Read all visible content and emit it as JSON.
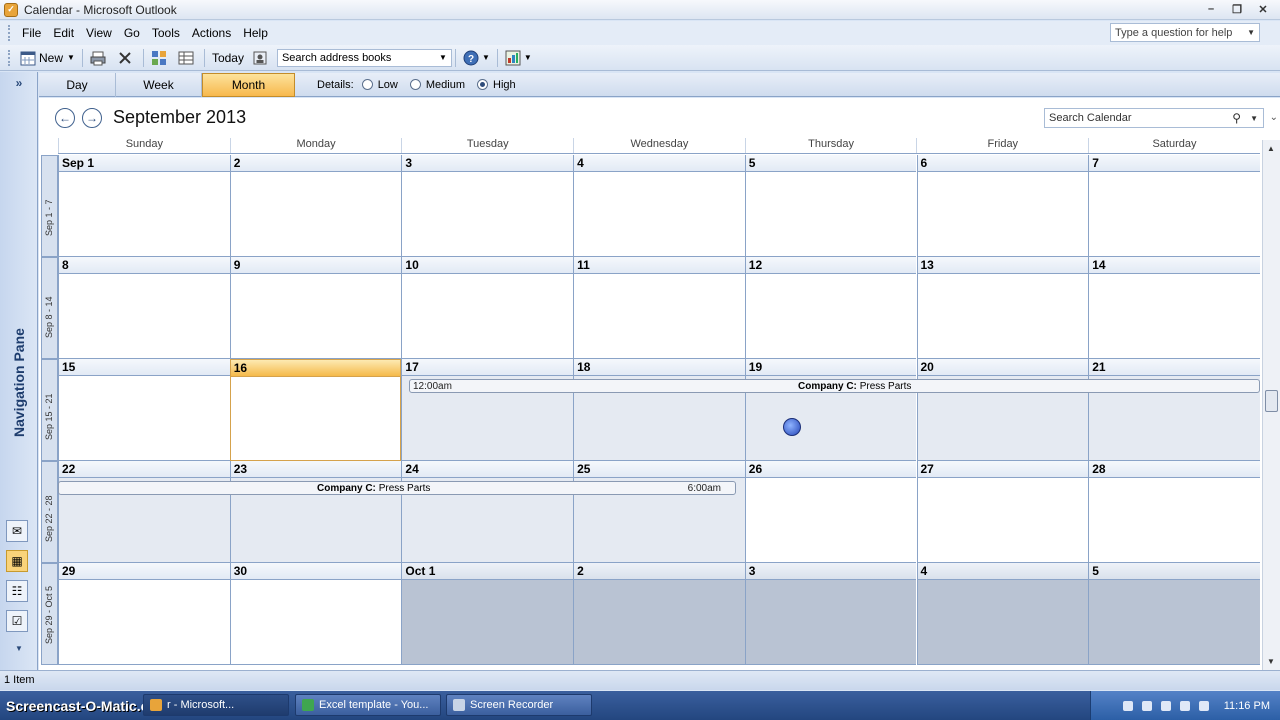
{
  "window": {
    "title": "Calendar - Microsoft Outlook"
  },
  "menu": [
    "File",
    "Edit",
    "View",
    "Go",
    "Tools",
    "Actions",
    "Help"
  ],
  "help": {
    "placeholder": "Type a question for help"
  },
  "toolbar": {
    "new_label": "New",
    "today_label": "Today",
    "address_search_placeholder": "Search address books"
  },
  "view_tabs": {
    "day": "Day",
    "week": "Week",
    "month": "Month"
  },
  "details": {
    "label": "Details:",
    "low": "Low",
    "medium": "Medium",
    "high": "High",
    "selected": "High"
  },
  "calendar": {
    "month_title": "September 2013",
    "search_placeholder": "Search Calendar",
    "weekdays": [
      "Sunday",
      "Monday",
      "Tuesday",
      "Wednesday",
      "Thursday",
      "Friday",
      "Saturday"
    ],
    "weeks": [
      {
        "label": "Sep 1 - 7",
        "days": [
          "Sep 1",
          "2",
          "3",
          "4",
          "5",
          "6",
          "7"
        ]
      },
      {
        "label": "Sep 8 - 14",
        "days": [
          "8",
          "9",
          "10",
          "11",
          "12",
          "13",
          "14"
        ]
      },
      {
        "label": "Sep 15 - 21",
        "days": [
          "15",
          "16",
          "17",
          "18",
          "19",
          "20",
          "21"
        ]
      },
      {
        "label": "Sep 22 - 28",
        "days": [
          "22",
          "23",
          "24",
          "25",
          "26",
          "27",
          "28"
        ]
      },
      {
        "label": "Sep 29 - Oct 5",
        "days": [
          "29",
          "30",
          "Oct 1",
          "2",
          "3",
          "4",
          "5"
        ]
      }
    ],
    "events": [
      {
        "company": "Company C:",
        "title": "Press Parts",
        "time": "12:00am"
      },
      {
        "company": "Company C:",
        "title": "Press Parts",
        "time": "6:00am"
      }
    ]
  },
  "nav_pane": {
    "label": "Navigation Pane"
  },
  "status": {
    "text": "1 Item"
  },
  "taskbar": {
    "brand": "Screencast-O-Matic.com",
    "buttons": [
      "r - Microsoft...",
      "Excel template - You...",
      "Screen Recorder"
    ],
    "clock": "11:16 PM"
  },
  "colors": {
    "accent": "#f7b84d",
    "frame": "#8aa3c7",
    "taskbar": "#23467f"
  }
}
